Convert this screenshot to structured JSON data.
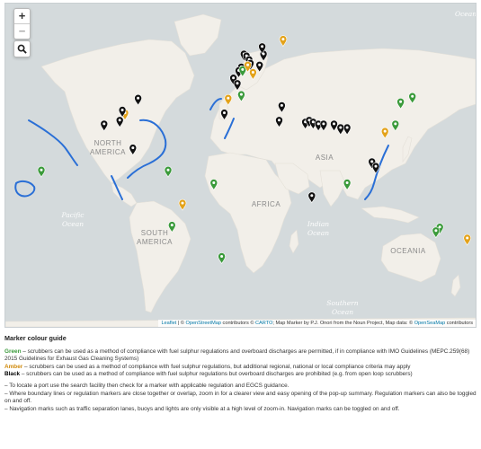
{
  "map": {
    "zoom_in_label": "+",
    "zoom_out_label": "−",
    "ocean_labels": [
      "Pacific",
      "Ocean",
      "Indian",
      "Ocean",
      "Southern",
      "Ocean",
      "Ocean"
    ],
    "continent_labels": [
      "NORTH",
      "AMERICA",
      "SOUTH",
      "AMERICA",
      "AFRICA",
      "ASIA",
      "OCEANIA"
    ],
    "attribution": {
      "leaflet": "Leaflet",
      "sep": " | © ",
      "osm": "OpenStreetMap",
      "contrib": " contributors © ",
      "carto": "CARTO",
      "marker": "; Map Marker by P.J. Onori from the Noun Project, Map data: © ",
      "openseamap": "OpenSeaMap",
      "tail": " contributors"
    },
    "colors": {
      "green": "#3a9a3a",
      "amber": "#e3a21a",
      "black": "#111111",
      "route": "#2a6fd6"
    },
    "markers": [
      {
        "lon": -86,
        "lat": 28,
        "c": "amber"
      },
      {
        "lon": -88,
        "lat": 29.5,
        "c": "black"
      },
      {
        "lon": -90,
        "lat": 24,
        "c": "black"
      },
      {
        "lon": -76,
        "lat": 36,
        "c": "black"
      },
      {
        "lon": -102,
        "lat": 22,
        "c": "black"
      },
      {
        "lon": -80,
        "lat": 9,
        "c": "black"
      },
      {
        "lon": -150,
        "lat": -3,
        "c": "green"
      },
      {
        "lon": -53,
        "lat": -3,
        "c": "green"
      },
      {
        "lon": -42,
        "lat": -21,
        "c": "amber"
      },
      {
        "lon": -50,
        "lat": -33,
        "c": "green"
      },
      {
        "lon": 5,
        "lat": 60,
        "c": "black"
      },
      {
        "lon": 7,
        "lat": 59,
        "c": "black"
      },
      {
        "lon": 9,
        "lat": 57,
        "c": "black"
      },
      {
        "lon": 10,
        "lat": 55,
        "c": "black"
      },
      {
        "lon": 3,
        "lat": 53,
        "c": "black"
      },
      {
        "lon": 1,
        "lat": 51,
        "c": "black"
      },
      {
        "lon": 4,
        "lat": 51.5,
        "c": "green"
      },
      {
        "lon": 8,
        "lat": 54,
        "c": "amber"
      },
      {
        "lon": 12,
        "lat": 50,
        "c": "amber"
      },
      {
        "lon": 17,
        "lat": 54,
        "c": "black"
      },
      {
        "lon": 20,
        "lat": 60,
        "c": "black"
      },
      {
        "lon": 19,
        "lat": 64,
        "c": "black"
      },
      {
        "lon": 35,
        "lat": 68,
        "c": "amber"
      },
      {
        "lon": -3,
        "lat": 47,
        "c": "black"
      },
      {
        "lon": 0,
        "lat": 44,
        "c": "black"
      },
      {
        "lon": -7,
        "lat": 36,
        "c": "amber"
      },
      {
        "lon": 3,
        "lat": 38,
        "c": "green"
      },
      {
        "lon": -10,
        "lat": 28,
        "c": "black"
      },
      {
        "lon": 34,
        "lat": 32,
        "c": "black"
      },
      {
        "lon": 32,
        "lat": 24,
        "c": "black"
      },
      {
        "lon": 52,
        "lat": 23,
        "c": "black"
      },
      {
        "lon": 55,
        "lat": 24,
        "c": "black"
      },
      {
        "lon": 58,
        "lat": 23,
        "c": "black"
      },
      {
        "lon": 62,
        "lat": 22,
        "c": "black"
      },
      {
        "lon": 66,
        "lat": 22,
        "c": "black"
      },
      {
        "lon": 74,
        "lat": 22,
        "c": "black"
      },
      {
        "lon": 79,
        "lat": 20,
        "c": "black"
      },
      {
        "lon": 84,
        "lat": 20,
        "c": "black"
      },
      {
        "lon": 57,
        "lat": -17,
        "c": "black"
      },
      {
        "lon": -18,
        "lat": -10,
        "c": "green"
      },
      {
        "lon": -12,
        "lat": -50,
        "c": "green"
      },
      {
        "lon": 103,
        "lat": 1.5,
        "c": "black"
      },
      {
        "lon": 106,
        "lat": -1,
        "c": "black"
      },
      {
        "lon": 113,
        "lat": 18,
        "c": "amber"
      },
      {
        "lon": 121,
        "lat": 22,
        "c": "green"
      },
      {
        "lon": 125,
        "lat": 34,
        "c": "green"
      },
      {
        "lon": 134,
        "lat": 37,
        "c": "green"
      },
      {
        "lon": 84,
        "lat": -10,
        "c": "green"
      },
      {
        "lon": 155,
        "lat": -34,
        "c": "green"
      },
      {
        "lon": 152,
        "lat": -36,
        "c": "green"
      },
      {
        "lon": 176,
        "lat": -40,
        "c": "amber"
      }
    ]
  },
  "guide": {
    "heading": "Marker colour guide",
    "green_label": "Green",
    "green_text": " – scrubbers can be used as a method of compliance with fuel sulphur regulations and overboard discharges are permitted, if in compliance with IMO Guidelines (MEPC.259(68) 2015 Guidelines for Exhaust Gas Cleaning Systems)",
    "amber_label": "Amber",
    "amber_text": " – scrubbers can be used as a method of compliance with fuel sulphur regulations, but additional regional, national or local compliance criteria may apply",
    "black_label": "Black",
    "black_text": " – scrubbers can be used as a method of compliance with fuel sulphur regulations but overboard discharges are prohibited (e.g. from open loop  scrubbers)",
    "notes": [
      "– To locate a port use the search facility then check for a marker with applicable regulation and EGCS guidance.",
      "– Where boundary lines or regulation markers are close together or overlap, zoom in for a clearer view and easy opening of the pop-up summary. Regulation markers can also be toggled on and off.",
      "– Navigation marks such as traffic separation lanes, buoys and lights are only visible at a high level of zoom-in. Navigation marks can be toggled on and off."
    ]
  }
}
